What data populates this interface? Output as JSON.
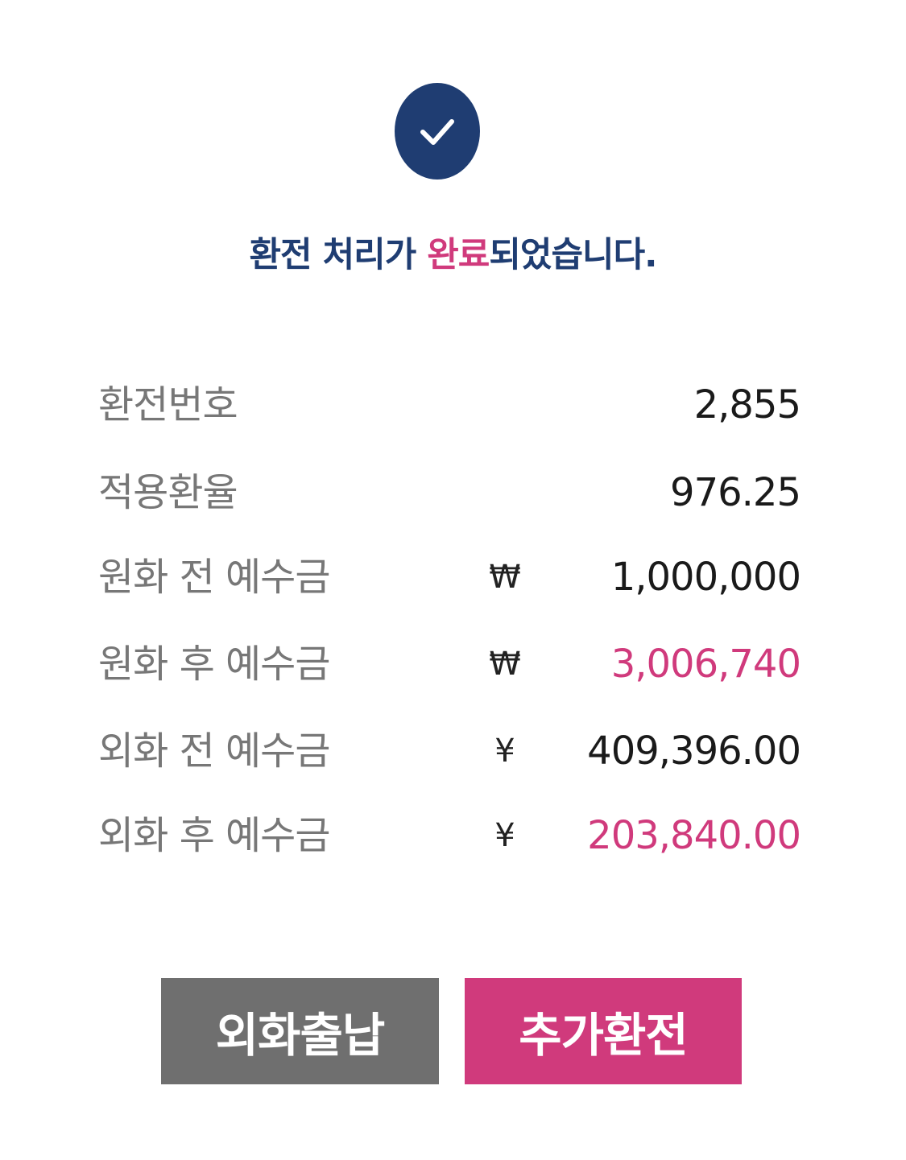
{
  "status": {
    "icon": "checkmark-icon",
    "message_part1": "환전 처리가 ",
    "message_accent": "완료",
    "message_part2": "되었습니다."
  },
  "details": [
    {
      "label": "환전번호",
      "currency": "",
      "value": "2,855",
      "highlight": false
    },
    {
      "label": "적용환율",
      "currency": "",
      "value": "976.25",
      "highlight": false
    },
    {
      "label": "원화 전 예수금",
      "currency": "₩",
      "value": "1,000,000",
      "highlight": false
    },
    {
      "label": "원화 후 예수금",
      "currency": "₩",
      "value": "3,006,740",
      "highlight": true
    },
    {
      "label": "외화 전 예수금",
      "currency": "¥",
      "value": "409,396.00",
      "highlight": false
    },
    {
      "label": "외화 후 예수금",
      "currency": "¥",
      "value": "203,840.00",
      "highlight": true
    }
  ],
  "buttons": {
    "foreign_deposit_withdraw": "외화출납",
    "additional_exchange": "추가환전"
  },
  "colors": {
    "navy": "#1f3d72",
    "accent_pink": "#d03a7c",
    "label_gray": "#777777",
    "button_gray": "#6f6f6f"
  }
}
